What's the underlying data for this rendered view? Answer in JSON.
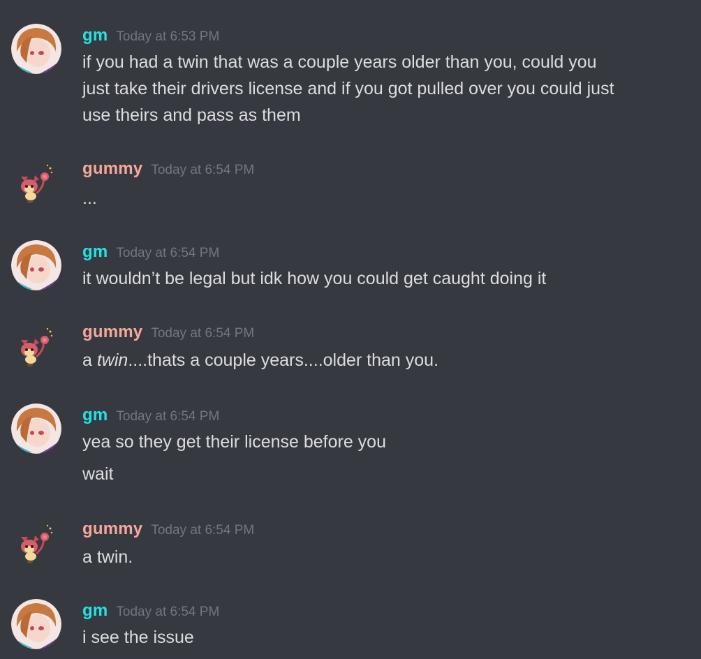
{
  "colors": {
    "background": "#36393f",
    "username_gm": "#23e3e3",
    "username_gummy": "#f5a89c",
    "timestamp": "#72767d",
    "text": "#dcddde"
  },
  "messages": [
    {
      "author": "gm",
      "avatar_icon": "anime-girl-avatar",
      "timestamp": "Today at 6:53 PM",
      "lines": [
        "if you had a twin that was a couple years older than you, could you",
        "just take their drivers license and if you got pulled over you could just",
        "use theirs and pass as them"
      ]
    },
    {
      "author": "gummy",
      "avatar_icon": "skitty-sprite-avatar",
      "timestamp": "Today at 6:54 PM",
      "lines": [
        "..."
      ]
    },
    {
      "author": "gm",
      "avatar_icon": "anime-girl-avatar",
      "timestamp": "Today at 6:54 PM",
      "lines": [
        "it wouldn’t be legal but idk how you could get caught doing it"
      ]
    },
    {
      "author": "gummy",
      "avatar_icon": "skitty-sprite-avatar",
      "timestamp": "Today at 6:54 PM",
      "segments": [
        {
          "text": "a ",
          "italic": false
        },
        {
          "text": "twin",
          "italic": true
        },
        {
          "text": "....thats a couple years....older than you.",
          "italic": false
        }
      ]
    },
    {
      "author": "gm",
      "avatar_icon": "anime-girl-avatar",
      "timestamp": "Today at 6:54 PM",
      "lines": [
        "yea so they get their license before you",
        "wait"
      ]
    },
    {
      "author": "gummy",
      "avatar_icon": "skitty-sprite-avatar",
      "timestamp": "Today at 6:54 PM",
      "lines": [
        "a twin."
      ]
    },
    {
      "author": "gm",
      "avatar_icon": "anime-girl-avatar",
      "timestamp": "Today at 6:54 PM",
      "lines": [
        "i see the issue"
      ]
    }
  ]
}
